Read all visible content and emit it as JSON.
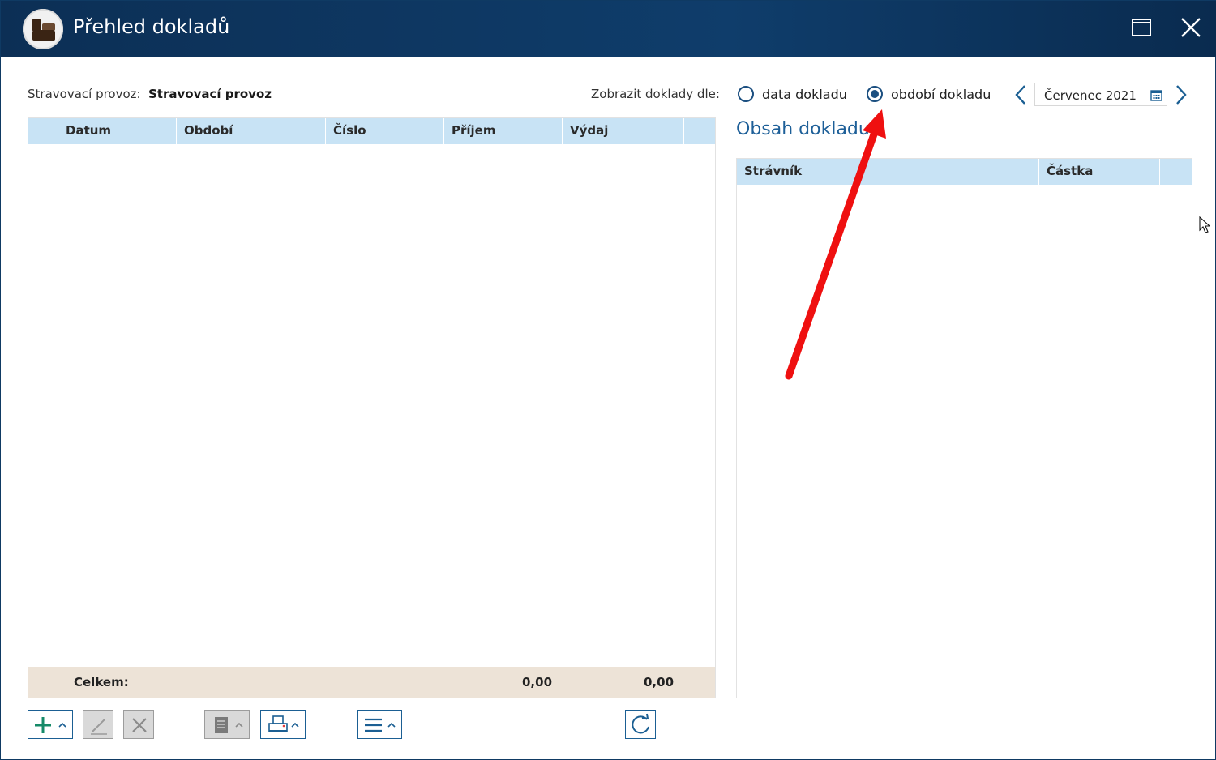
{
  "window": {
    "title": "Přehled dokladů",
    "controls": {
      "maximize_icon": "maximize-icon",
      "close_icon": "close-icon"
    }
  },
  "filter": {
    "provoz_label": "Stravovací provoz:",
    "provoz_value": "Stravovací provoz",
    "zobrazit_label": "Zobrazit doklady dle:",
    "options": [
      {
        "label": "data dokladu",
        "selected": false
      },
      {
        "label": "období dokladu",
        "selected": true
      }
    ],
    "period_value": "Červenec 2021"
  },
  "left_table": {
    "columns": [
      "Datum",
      "Období",
      "Číslo",
      "Příjem",
      "Výdaj"
    ],
    "rows": [],
    "footer": {
      "label": "Celkem:",
      "prijem_total": "0,00",
      "vydaj_total": "0,00"
    }
  },
  "right_panel": {
    "title": "Obsah dokladu",
    "columns": [
      "Strávník",
      "Částka"
    ],
    "rows": []
  },
  "toolbar": {
    "buttons": [
      "add",
      "edit",
      "delete",
      "document",
      "print",
      "menu",
      "refresh"
    ]
  },
  "colors": {
    "titlebar": "#0f3d6b",
    "header_bg": "#c8e3f5",
    "footer_bg": "#ede3d7",
    "accent": "#1b5f93",
    "annotation_arrow": "#ef1010"
  }
}
